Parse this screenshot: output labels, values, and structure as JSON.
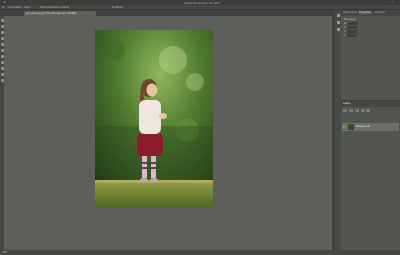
{
  "app": {
    "title": "Adobe Photoshop CC 2017"
  },
  "options": {
    "items": [
      "Auto-Select:",
      "Layer",
      "Show Transform Controls",
      "3D Mode:"
    ]
  },
  "document": {
    "tab_label": "girl_photo.jpg @ 25% (Background, RGB/8)",
    "zoom": "25%"
  },
  "panels": {
    "tabs": [
      "Adjustments",
      "Properties",
      "Libraries"
    ],
    "properties": {
      "rows": [
        "Pixel Layer",
        "W:",
        "H:",
        "X:",
        "Y:"
      ]
    },
    "layers": {
      "tab": "Layers",
      "layer_name": "Background"
    }
  }
}
